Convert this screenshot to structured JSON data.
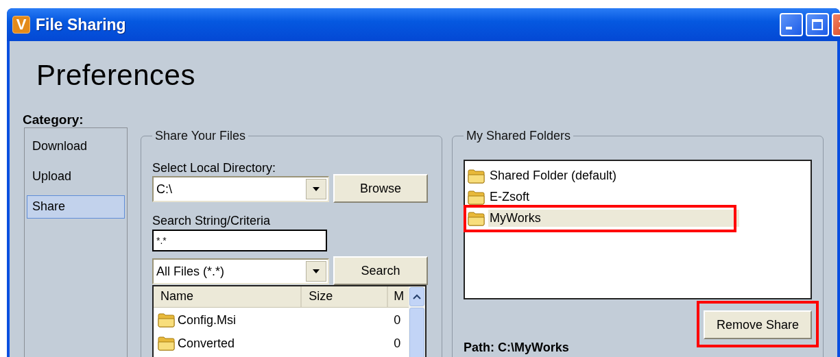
{
  "window": {
    "app_icon_letter": "V",
    "title": "File Sharing"
  },
  "heading": "Preferences",
  "category": {
    "label": "Category:",
    "items": [
      {
        "label": "Download",
        "selected": false
      },
      {
        "label": "Upload",
        "selected": false
      },
      {
        "label": "Share",
        "selected": true
      }
    ]
  },
  "share_files": {
    "title": "Share Your Files",
    "directory_label": "Select Local Directory:",
    "directory_value": "C:\\",
    "browse_button": "Browse",
    "search_label": "Search String/Criteria",
    "search_value": "*.*",
    "filter_value": "All Files (*.*)",
    "search_button": "Search",
    "file_list": {
      "columns": [
        "Name",
        "Size",
        "M"
      ],
      "rows": [
        {
          "cells": [
            "Config.Msi",
            "",
            "0"
          ]
        },
        {
          "cells": [
            "Converted",
            "",
            "0"
          ]
        }
      ]
    }
  },
  "shared_folders": {
    "title": "My Shared Folders",
    "items": [
      {
        "label": "Shared Folder (default)",
        "selected": false,
        "highlighted": false
      },
      {
        "label": "E-Zsoft",
        "selected": false,
        "highlighted": false
      },
      {
        "label": "MyWorks",
        "selected": true,
        "highlighted": true
      }
    ],
    "remove_button": {
      "label": "Remove Share",
      "highlighted": true
    },
    "path": "Path: C:\\MyWorks"
  }
}
